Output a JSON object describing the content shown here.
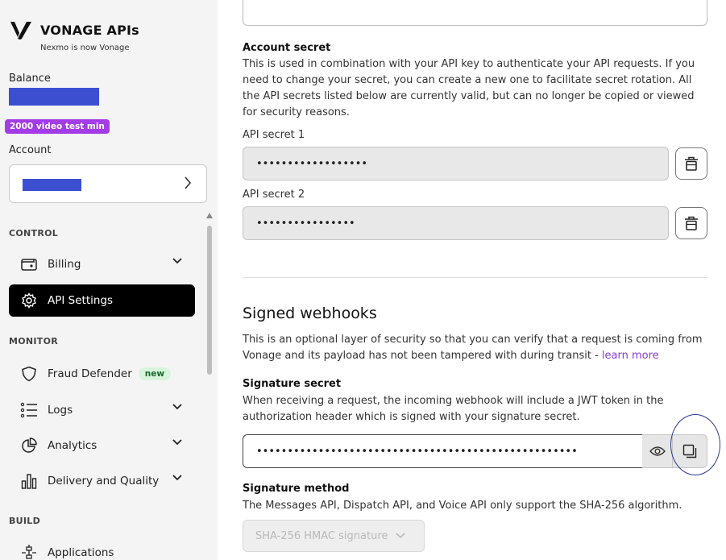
{
  "brand": {
    "name": "VONAGE APIs",
    "tagline": "Nexmo is now Vonage"
  },
  "sidebar": {
    "balance_label": "Balance",
    "video_badge": "2000 video test min",
    "account_label": "Account",
    "sections": {
      "control": "CONTROL",
      "monitor": "MONITOR",
      "build": "BUILD"
    },
    "items": {
      "billing": "Billing",
      "api_settings": "API Settings",
      "fraud_defender": "Fraud Defender",
      "fraud_badge": "new",
      "logs": "Logs",
      "analytics": "Analytics",
      "delivery": "Delivery and Quality",
      "applications": "Applications"
    },
    "active_color": "#000000",
    "accent_badge_color": "#a33ce6"
  },
  "main": {
    "account_secret": {
      "heading": "Account secret",
      "description": "This is used in combination with your API key to authenticate your API requests. If you need to change your secret, you can create a new one to facilitate secret rotation. All the API secrets listed below are currently valid, but can no longer be copied or viewed for security reasons.",
      "secret1_label": "API secret 1",
      "secret1_value": "••••••••••••••••••",
      "secret2_label": "API secret 2",
      "secret2_value": "••••••••••••••••"
    },
    "signed_webhooks": {
      "heading": "Signed webhooks",
      "description": "This is an optional layer of security so that you can verify that a request is coming from Vonage and its payload has not been tampered with during transit - ",
      "learn_more": "learn more",
      "signature_secret_heading": "Signature secret",
      "signature_secret_description": "When receiving a request, the incoming webhook will include a JWT token in the authorization header which is signed with your signature secret.",
      "signature_secret_value": "••••••••••••••••••••••••••••••••••••••••••••••••••••",
      "signature_method_heading": "Signature method",
      "signature_method_description": "The Messages API, Dispatch API, and Voice API only support the SHA-256 algorithm.",
      "signature_method_value": "SHA-256 HMAC signature"
    },
    "link_color": "#8a3dd6"
  }
}
